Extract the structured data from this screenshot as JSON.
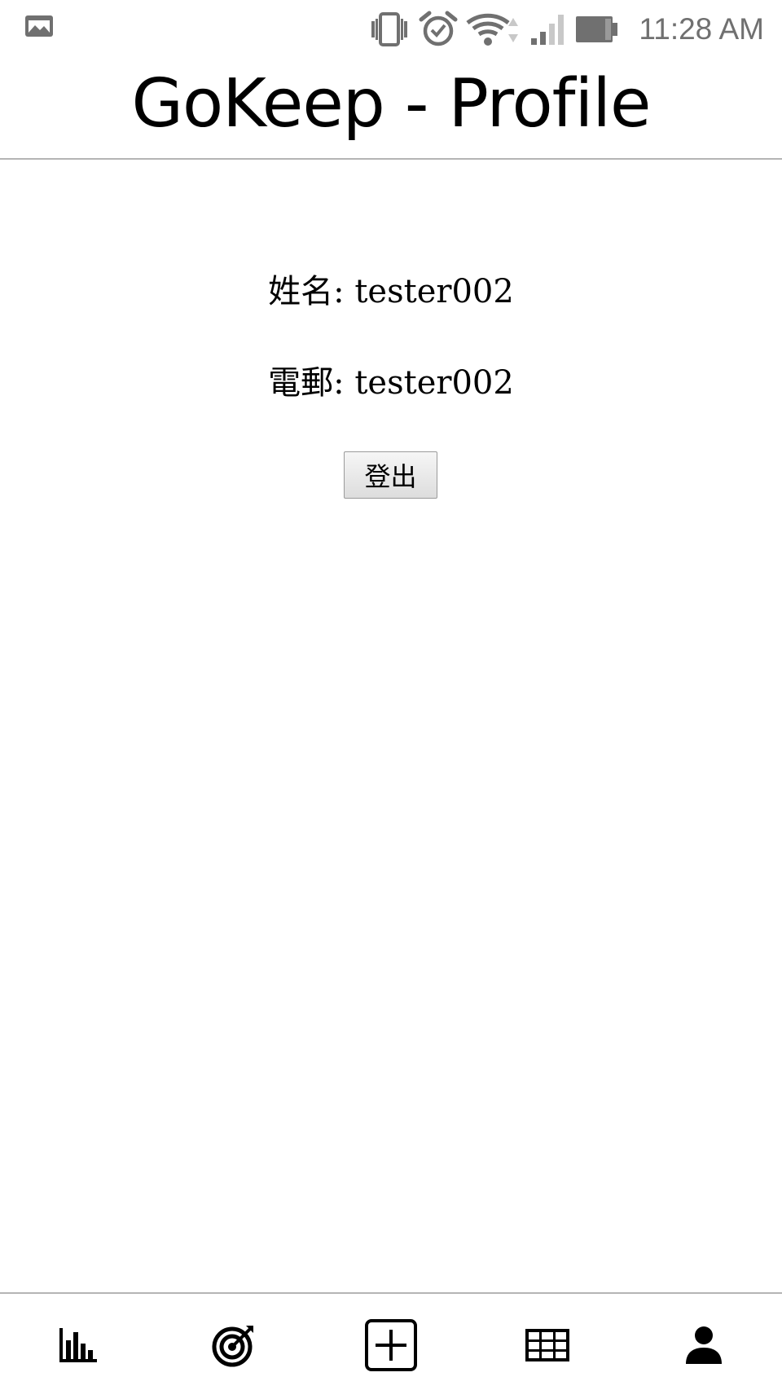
{
  "status_bar": {
    "time": "11:28 AM",
    "icons": [
      "image-notification-icon",
      "vibrate-icon",
      "alarm-icon",
      "wifi-icon",
      "cell-signal-icon",
      "battery-icon"
    ]
  },
  "header": {
    "title": "GoKeep - Profile"
  },
  "profile": {
    "name_label": "姓名:",
    "name_value": "tester002",
    "email_label": "電郵:",
    "email_value": "tester002"
  },
  "actions": {
    "logout_label": "登出"
  },
  "bottom_nav": {
    "items": [
      {
        "icon": "bar-chart-icon",
        "active": false
      },
      {
        "icon": "target-icon",
        "active": false
      },
      {
        "icon": "add-box-icon",
        "active": false
      },
      {
        "icon": "table-grid-icon",
        "active": false
      },
      {
        "icon": "person-icon",
        "active": true
      }
    ]
  },
  "colors": {
    "status_icons": "#707070",
    "divider": "#b5b5b5",
    "nav_icon": "#000000"
  }
}
